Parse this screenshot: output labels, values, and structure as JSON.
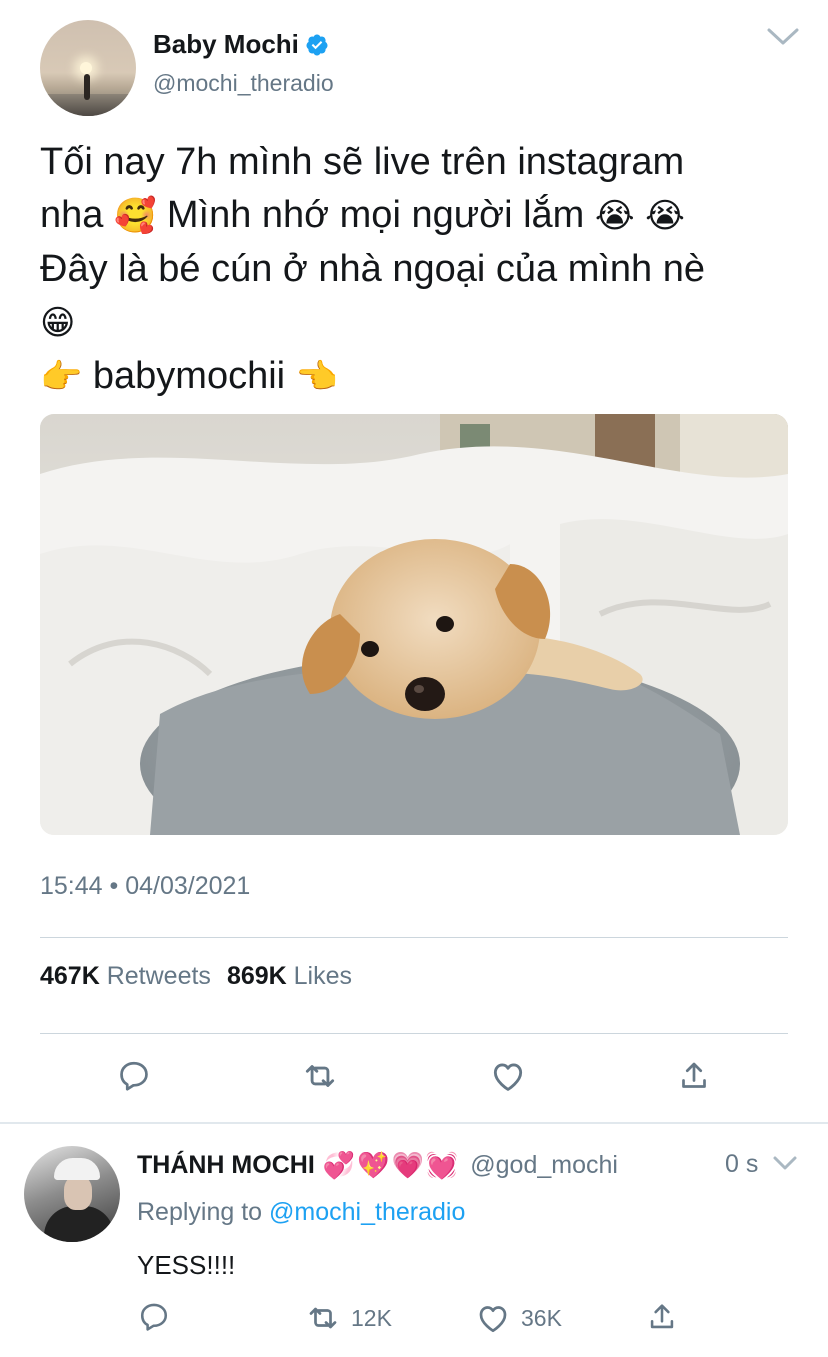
{
  "tweet": {
    "display_name": "Baby Mochi",
    "handle": "@mochi_theradio",
    "verified_icon": "verified-badge-icon",
    "text_lines": [
      "Tối nay 7h mình sẽ live trên instagram",
      "nha",
      "Mình nhớ mọi người lắm",
      "Đây là bé cún ở nhà ngoại của mình nè",
      "babymochii"
    ],
    "emoji": {
      "hearts_face": "🥰",
      "crying": "😭",
      "grin": "😁",
      "point_right": "👉",
      "point_left": "👈"
    },
    "timestamp": "15:44 • 04/03/2021",
    "retweet_count": "467K",
    "retweet_label": "Retweets",
    "like_count": "869K",
    "like_label": "Likes",
    "actions": [
      "reply-icon",
      "retweet-icon",
      "like-icon",
      "share-icon"
    ]
  },
  "reply": {
    "display_name": "THÁNH MOCHI",
    "emojis": "💞💖💗💓",
    "handle": "@god_mochi",
    "time": "0 s",
    "replying_prefix": "Replying to",
    "replying_to": "@mochi_theradio",
    "text": "YESS!!!!",
    "retweet_count": "12K",
    "like_count": "36K"
  },
  "colors": {
    "accent": "#1da1f2",
    "secondary_text": "#657786",
    "primary_text": "#14171a",
    "divider": "#ccd6dd"
  }
}
